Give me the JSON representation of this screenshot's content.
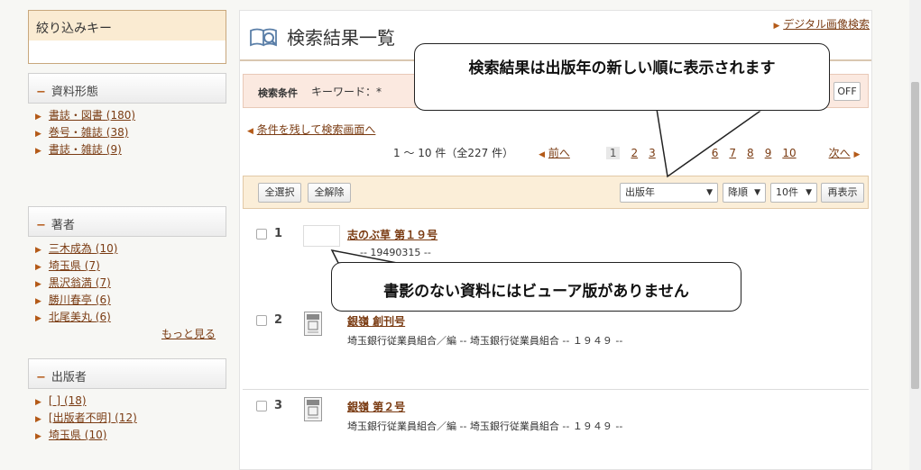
{
  "sidebar": {
    "title": "絞り込みキー",
    "facets": [
      {
        "heading": "資料形態",
        "items": [
          {
            "label": "書誌・図書",
            "count": "(180)"
          },
          {
            "label": "巻号・雑誌",
            "count": "(38)"
          },
          {
            "label": "書誌・雑誌",
            "count": "(9)"
          }
        ]
      },
      {
        "heading": "著者",
        "items": [
          {
            "label": "三木成為",
            "count": "(10)"
          },
          {
            "label": "埼玉県",
            "count": "(7)"
          },
          {
            "label": "黒沢翁満",
            "count": "(7)"
          },
          {
            "label": "勝川春亭",
            "count": "(6)"
          },
          {
            "label": "北尾美丸",
            "count": "(6)"
          }
        ],
        "more": "もっと見る"
      },
      {
        "heading": "出版者",
        "items": [
          {
            "label": "[ ]",
            "count": "(18)"
          },
          {
            "label": "[出版者不明]",
            "count": "(12)"
          },
          {
            "label": "埼玉県",
            "count": "(10)"
          }
        ]
      }
    ]
  },
  "main": {
    "title": "検索結果一覧",
    "digital_link": "デジタル画像検索",
    "condition_label": "検索条件",
    "condition_text": "キーワード：*",
    "off_label": "OFF",
    "back_link": "条件を残して検索画面へ",
    "pager": {
      "count_text": "1 ～ 10 件（全227 件）",
      "prev": "前へ",
      "pages": [
        "1",
        "2",
        "3",
        "6",
        "7",
        "8",
        "9",
        "10"
      ],
      "current": "1",
      "next": "次へ"
    },
    "toolbar": {
      "select_all": "全選択",
      "deselect_all": "全解除",
      "sort_field": "出版年",
      "sort_order": "降順",
      "per_page": "10件",
      "redisplay": "再表示"
    },
    "results": [
      {
        "num": "1",
        "title": "志のぶ草 第１９号",
        "meta": "-- 19490315 --"
      },
      {
        "num": "2",
        "title": "銀嶺 創刊号",
        "meta": "埼玉銀行従業員組合／編 -- 埼玉銀行従業員組合 -- １９４９ --"
      },
      {
        "num": "3",
        "title": "銀嶺 第２号",
        "meta": "埼玉銀行従業員組合／編 -- 埼玉銀行従業員組合 -- １９４９ --"
      }
    ]
  },
  "callouts": {
    "sort_note": "検索結果は出版年の新しい順に表示されます",
    "thumb_note": "書影のない資料にはビューア版がありません"
  },
  "colors": {
    "link": "#7a3b12",
    "accent": "#b45a18",
    "condition_bg": "#fbe9e0",
    "toolbar_bg": "#fbeed8"
  }
}
